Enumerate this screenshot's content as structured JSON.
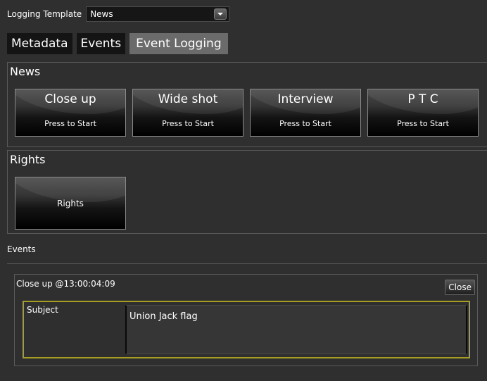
{
  "template": {
    "label": "Logging Template",
    "selected": "News"
  },
  "tabs": [
    {
      "label": "Metadata",
      "active": false
    },
    {
      "label": "Events",
      "active": false
    },
    {
      "label": "Event Logging",
      "active": true
    }
  ],
  "news": {
    "title": "News",
    "buttons": [
      {
        "title": "Close up",
        "subtitle": "Press to Start"
      },
      {
        "title": "Wide shot",
        "subtitle": "Press to Start"
      },
      {
        "title": "Interview",
        "subtitle": "Press to Start"
      },
      {
        "title": "P T C",
        "subtitle": "Press to Start"
      }
    ]
  },
  "rights": {
    "title": "Rights",
    "buttons": [
      {
        "label": "Rights"
      }
    ]
  },
  "events": {
    "heading": "Events",
    "items": [
      {
        "title": "Close up @13:00:04:09",
        "close_label": "Close",
        "field_label": "Subject",
        "field_value": "Union Jack flag"
      }
    ]
  },
  "colors": {
    "background": "#2f2f2f",
    "tab_active": "#6b6b6b",
    "field_highlight": "#a59e22"
  }
}
